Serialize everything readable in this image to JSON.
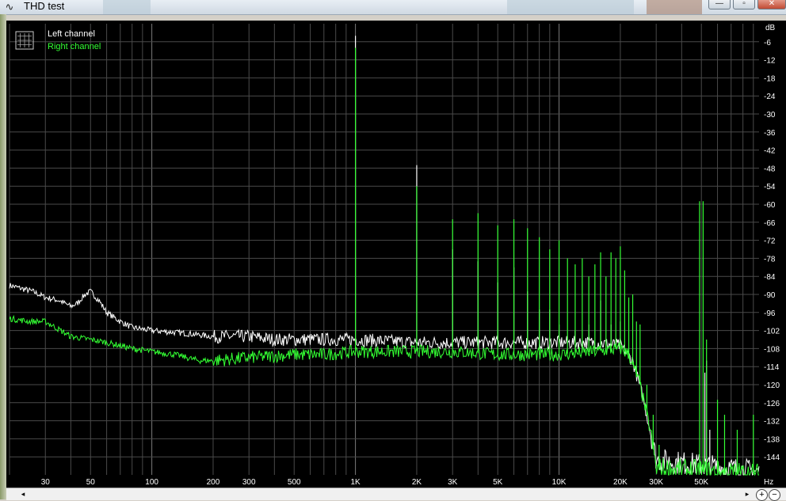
{
  "window": {
    "title": "THD test",
    "app_icon": "waveform-icon",
    "controls": {
      "minimize": "—",
      "maximize": "▫",
      "close": "✕"
    }
  },
  "chart_data": {
    "type": "line",
    "xlabel": "Hz",
    "ylabel": "dB",
    "x_scale": "log",
    "xlim": [
      20,
      96000
    ],
    "ylim": [
      -150,
      0
    ],
    "grid": true,
    "legend": "top-left",
    "legend_icon": "grid-icon",
    "x_ticks": [
      {
        "v": 30,
        "label": "30"
      },
      {
        "v": 50,
        "label": "50"
      },
      {
        "v": 100,
        "label": "100"
      },
      {
        "v": 200,
        "label": "200"
      },
      {
        "v": 300,
        "label": "300"
      },
      {
        "v": 500,
        "label": "500"
      },
      {
        "v": 1000,
        "label": "1K"
      },
      {
        "v": 2000,
        "label": "2K"
      },
      {
        "v": 3000,
        "label": "3K"
      },
      {
        "v": 5000,
        "label": "5K"
      },
      {
        "v": 10000,
        "label": "10K"
      },
      {
        "v": 20000,
        "label": "20K"
      },
      {
        "v": 30000,
        "label": "30K"
      },
      {
        "v": 50000,
        "label": "50K"
      }
    ],
    "y_ticks": [
      -6,
      -12,
      -18,
      -24,
      -30,
      -36,
      -42,
      -48,
      -54,
      -60,
      -66,
      -72,
      -78,
      -84,
      -90,
      -96,
      -102,
      -108,
      -114,
      -120,
      -126,
      -132,
      -138,
      -144
    ],
    "series": [
      {
        "name": "Left channel",
        "color": "#ffffff",
        "baseline": [
          [
            20,
            -87
          ],
          [
            26,
            -89
          ],
          [
            30,
            -91
          ],
          [
            35,
            -92
          ],
          [
            40,
            -94
          ],
          [
            43,
            -93
          ],
          [
            47,
            -90
          ],
          [
            50,
            -89
          ],
          [
            55,
            -92
          ],
          [
            60,
            -96
          ],
          [
            70,
            -99
          ],
          [
            80,
            -101
          ],
          [
            100,
            -102
          ],
          [
            150,
            -103
          ],
          [
            200,
            -104
          ],
          [
            300,
            -104
          ],
          [
            400,
            -105
          ],
          [
            500,
            -105
          ],
          [
            700,
            -105
          ],
          [
            1000,
            -105
          ],
          [
            2000,
            -106
          ],
          [
            3000,
            -106
          ],
          [
            5000,
            -106
          ],
          [
            10000,
            -106
          ],
          [
            15000,
            -106
          ],
          [
            20000,
            -107
          ],
          [
            23000,
            -112
          ],
          [
            26000,
            -125
          ],
          [
            28000,
            -135
          ],
          [
            30000,
            -145
          ],
          [
            96000,
            -149
          ]
        ],
        "peaks": [
          [
            1000,
            -4
          ],
          [
            2000,
            -47
          ],
          [
            3000,
            -75
          ],
          [
            4000,
            -79
          ],
          [
            5000,
            -86
          ],
          [
            6000,
            -81
          ],
          [
            7000,
            -89
          ],
          [
            8000,
            -95
          ],
          [
            9000,
            -95
          ],
          [
            10000,
            -100
          ],
          [
            12000,
            -102
          ],
          [
            14000,
            -100
          ],
          [
            16000,
            -92
          ],
          [
            18000,
            -100
          ],
          [
            20000,
            -99
          ],
          [
            52000,
            -116
          ],
          [
            53000,
            -112
          ],
          [
            55000,
            -135
          ]
        ]
      },
      {
        "name": "Right channel",
        "color": "#33ff33",
        "baseline": [
          [
            20,
            -98
          ],
          [
            25,
            -99
          ],
          [
            30,
            -99
          ],
          [
            40,
            -104
          ],
          [
            50,
            -105
          ],
          [
            60,
            -106
          ],
          [
            70,
            -107
          ],
          [
            80,
            -108
          ],
          [
            100,
            -109
          ],
          [
            130,
            -110
          ],
          [
            170,
            -112
          ],
          [
            200,
            -112
          ],
          [
            300,
            -111
          ],
          [
            500,
            -110
          ],
          [
            700,
            -110
          ],
          [
            1000,
            -109
          ],
          [
            2000,
            -109
          ],
          [
            3000,
            -109
          ],
          [
            5000,
            -110
          ],
          [
            10000,
            -110
          ],
          [
            15000,
            -109
          ],
          [
            20000,
            -108
          ],
          [
            22000,
            -110
          ],
          [
            25000,
            -120
          ],
          [
            28000,
            -135
          ],
          [
            30000,
            -148
          ],
          [
            96000,
            -150
          ]
        ],
        "peaks": [
          [
            1000,
            -8
          ],
          [
            2000,
            -54
          ],
          [
            3000,
            -65
          ],
          [
            4000,
            -63
          ],
          [
            5000,
            -67
          ],
          [
            6000,
            -65
          ],
          [
            7000,
            -68
          ],
          [
            8000,
            -71
          ],
          [
            9000,
            -75
          ],
          [
            10000,
            -72
          ],
          [
            11000,
            -78
          ],
          [
            12000,
            -80
          ],
          [
            13000,
            -78
          ],
          [
            14000,
            -84
          ],
          [
            15000,
            -80
          ],
          [
            16000,
            -76
          ],
          [
            17000,
            -84
          ],
          [
            18000,
            -76
          ],
          [
            19000,
            -78
          ],
          [
            20000,
            -74
          ],
          [
            21000,
            -82
          ],
          [
            22000,
            -91
          ],
          [
            23000,
            -90
          ],
          [
            24000,
            -99
          ],
          [
            25000,
            -100
          ],
          [
            27000,
            -120
          ],
          [
            29000,
            -130
          ],
          [
            31000,
            -140
          ],
          [
            49000,
            -59
          ],
          [
            51000,
            -59
          ],
          [
            53000,
            -105
          ],
          [
            60000,
            -125
          ],
          [
            65000,
            -130
          ],
          [
            75000,
            -135
          ],
          [
            90000,
            -130
          ]
        ]
      }
    ]
  },
  "scrollbar": {
    "left_arrow": "◂",
    "right_arrow": "▸",
    "zoom_in": "+",
    "zoom_out": "−"
  }
}
